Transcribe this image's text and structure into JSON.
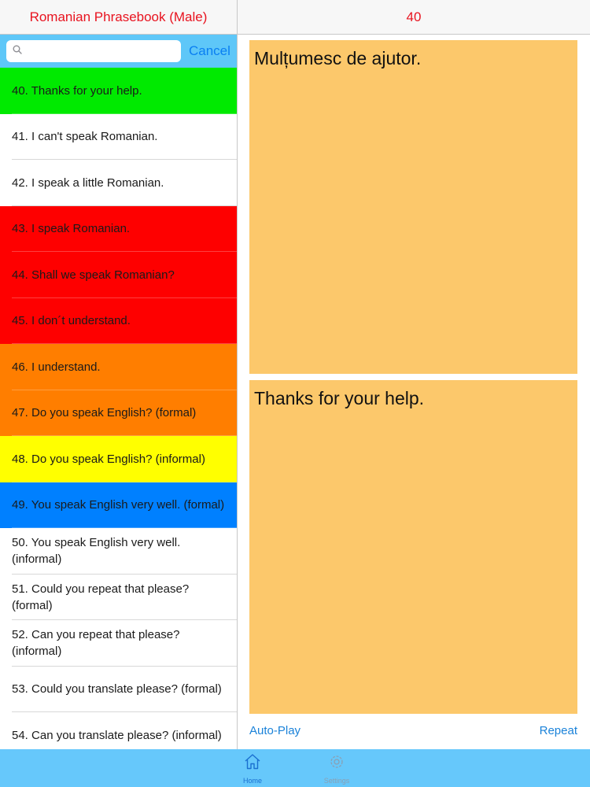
{
  "header": {
    "left_title": "Romanian Phrasebook (Male)",
    "right_title": "40"
  },
  "search": {
    "placeholder": "",
    "value": "",
    "cancel_label": "Cancel"
  },
  "phrases": [
    {
      "label": "40. Thanks for your help.",
      "bg": "#00ea00"
    },
    {
      "label": "41. I can't speak Romanian.",
      "bg": "#ffffff"
    },
    {
      "label": "42. I speak a little Romanian.",
      "bg": "#ffffff"
    },
    {
      "label": "43. I speak Romanian.",
      "bg": "#fe0000"
    },
    {
      "label": "44. Shall we speak Romanian?",
      "bg": "#fe0000"
    },
    {
      "label": "45. I don´t understand.",
      "bg": "#fe0000"
    },
    {
      "label": "46. I understand.",
      "bg": "#ff7e00"
    },
    {
      "label": "47. Do you speak English? (formal)",
      "bg": "#ff7e00"
    },
    {
      "label": "48. Do you speak English? (informal)",
      "bg": "#ffff00"
    },
    {
      "label": "49. You speak English very well. (formal)",
      "bg": "#0080ff"
    },
    {
      "label": "50. You speak English very well. (informal)",
      "bg": "#ffffff"
    },
    {
      "label": "51. Could you repeat that please? (formal)",
      "bg": "#ffffff"
    },
    {
      "label": "52. Can you repeat that please? (informal)",
      "bg": "#ffffff"
    },
    {
      "label": "53. Could you translate please? (formal)",
      "bg": "#ffffff"
    },
    {
      "label": "54. Can you translate please? (informal)",
      "bg": "#ffffff"
    }
  ],
  "detail": {
    "romanian": "Mulțumesc de ajutor.",
    "english": "Thanks for your help."
  },
  "controls": {
    "autoplay_label": "Auto-Play",
    "repeat_label": "Repeat"
  },
  "tabs": {
    "home_label": "Home",
    "settings_label": "Settings"
  },
  "icons": {
    "search": "search-icon",
    "home": "home-icon",
    "settings": "gear-icon"
  },
  "colors": {
    "title": "#e8131f",
    "accent": "#0a7ff2",
    "panel": "#fcc86b",
    "tab_bar": "#66c8fb"
  }
}
